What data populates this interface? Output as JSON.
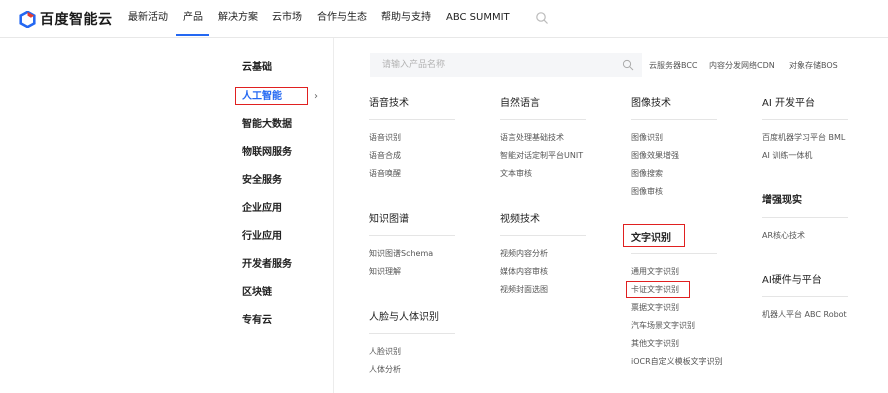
{
  "header": {
    "logo_text": "百度智能云",
    "nav": [
      "最新活动",
      "产品",
      "解决方案",
      "云市场",
      "合作与生态",
      "帮助与支持",
      "ABC SUMMIT"
    ],
    "active_nav": "产品"
  },
  "sidebar": {
    "items": [
      "云基础",
      "人工智能",
      "智能大数据",
      "物联网服务",
      "安全服务",
      "企业应用",
      "行业应用",
      "开发者服务",
      "区块链",
      "专有云"
    ],
    "selected": "人工智能",
    "arrow": "›"
  },
  "search": {
    "placeholder": "请输入产品名称",
    "quick_links": [
      "云服务器BCC",
      "内容分发网络CDN",
      "对象存储BOS"
    ]
  },
  "groups": {
    "voice": {
      "title": "语音技术",
      "items": [
        "语音识别",
        "语音合成",
        "语音唤醒"
      ]
    },
    "nlp": {
      "title": "自然语言",
      "items": [
        "语言处理基础技术",
        "智能对话定制平台UNIT",
        "文本审核"
      ]
    },
    "image": {
      "title": "图像技术",
      "items": [
        "图像识别",
        "图像效果增强",
        "图像搜索",
        "图像审核"
      ]
    },
    "aidev": {
      "title": "AI 开发平台",
      "items": [
        "百度机器学习平台 BML",
        "AI 训练一体机"
      ]
    },
    "kg": {
      "title": "知识图谱",
      "items": [
        "知识图谱Schema",
        "知识理解"
      ]
    },
    "video": {
      "title": "视频技术",
      "items": [
        "视频内容分析",
        "媒体内容审核",
        "视频封面选图"
      ]
    },
    "ocr": {
      "title": "文字识别",
      "items": [
        "通用文字识别",
        "卡证文字识别",
        "票据文字识别",
        "汽车场景文字识别",
        "其他文字识别",
        "iOCR自定义模板文字识别"
      ]
    },
    "ar": {
      "title": "增强现实",
      "items": [
        "AR核心技术"
      ]
    },
    "aihw": {
      "title": "AI硬件与平台",
      "items": [
        "机器人平台 ABC Robot"
      ]
    },
    "face": {
      "title": "人脸与人体识别",
      "items": [
        "人脸识别",
        "人体分析"
      ]
    }
  },
  "colors": {
    "accent": "#2468f2",
    "highlight_box": "#e02020",
    "logo_blue": "#2468f2"
  }
}
